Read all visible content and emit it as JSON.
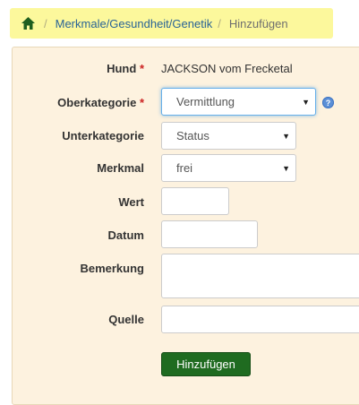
{
  "breadcrumb": {
    "home_icon": "home-icon",
    "separator": "/",
    "link": "Merkmale/Gesundheit/Genetik",
    "current": "Hinzufügen"
  },
  "form": {
    "hund": {
      "label": "Hund",
      "required_mark": "*",
      "value": "JACKSON vom Frecketal"
    },
    "oberkategorie": {
      "label": "Oberkategorie",
      "required_mark": "*",
      "value": "Vermittlung",
      "help_icon": "question-icon",
      "help_glyph": "?"
    },
    "unterkategorie": {
      "label": "Unterkategorie",
      "value": "Status"
    },
    "merkmal": {
      "label": "Merkmal",
      "value": "frei"
    },
    "wert": {
      "label": "Wert",
      "value": ""
    },
    "datum": {
      "label": "Datum",
      "value": ""
    },
    "bemerkung": {
      "label": "Bemerkung",
      "value": ""
    },
    "quelle": {
      "label": "Quelle",
      "value": ""
    },
    "submit_label": "Hinzufügen"
  },
  "colors": {
    "breadcrumb_bg": "#fcf89c",
    "panel_bg": "#fdf2df",
    "link": "#2a6496",
    "required": "#cc2222",
    "button_bg": "#1f6b20",
    "focus_border": "#66afe9"
  }
}
